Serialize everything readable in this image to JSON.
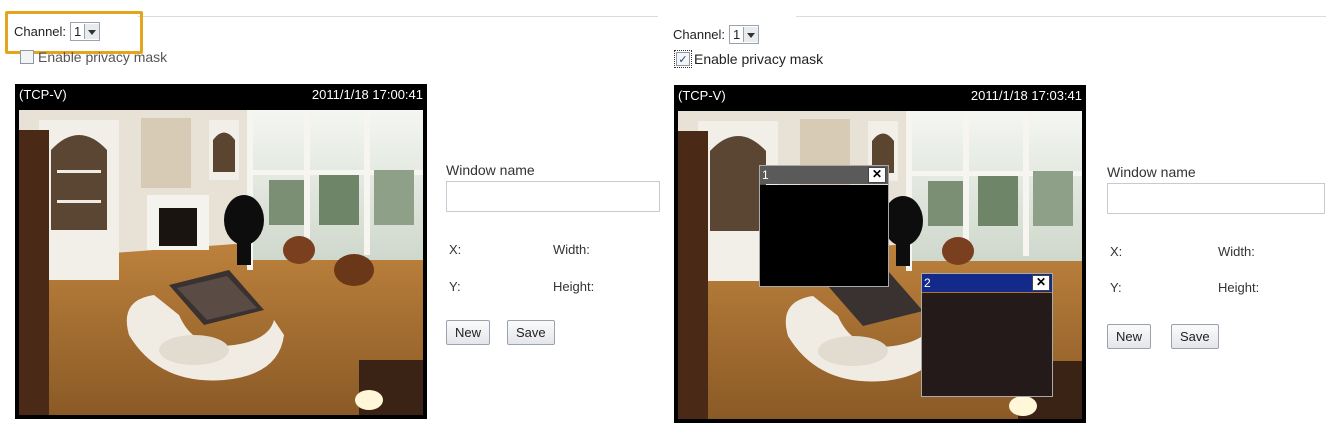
{
  "left_panel": {
    "channel_label": "Channel:",
    "channel_value": "1",
    "privacy_label": "Enable privacy mask",
    "privacy_checked": false,
    "video": {
      "stream_label": "(TCP-V)",
      "timestamp": "2011/1/18 17:00:41"
    },
    "window_name_label": "Window name",
    "window_name_value": "",
    "x_label": "X:",
    "y_label": "Y:",
    "width_label": "Width:",
    "height_label": "Height:",
    "new_label": "New",
    "save_label": "Save",
    "highlight_color": "#e3a51c"
  },
  "right_panel": {
    "channel_label": "Channel:",
    "channel_value": "1",
    "privacy_label": "Enable privacy mask",
    "privacy_checked": true,
    "checkmark": "✓",
    "video": {
      "stream_label": "(TCP-V)",
      "timestamp": "2011/1/18 17:03:41"
    },
    "masks": [
      {
        "number": "1",
        "close": "✕",
        "title_color": "#5a5a5a",
        "body_color": "#000000"
      },
      {
        "number": "2",
        "close": "✕",
        "title_color": "#142a8a",
        "body_color": "#241a1a"
      }
    ],
    "window_name_label": "Window name",
    "window_name_value": "",
    "x_label": "X:",
    "y_label": "Y:",
    "width_label": "Width:",
    "height_label": "Height:",
    "new_label": "New",
    "save_label": "Save"
  }
}
